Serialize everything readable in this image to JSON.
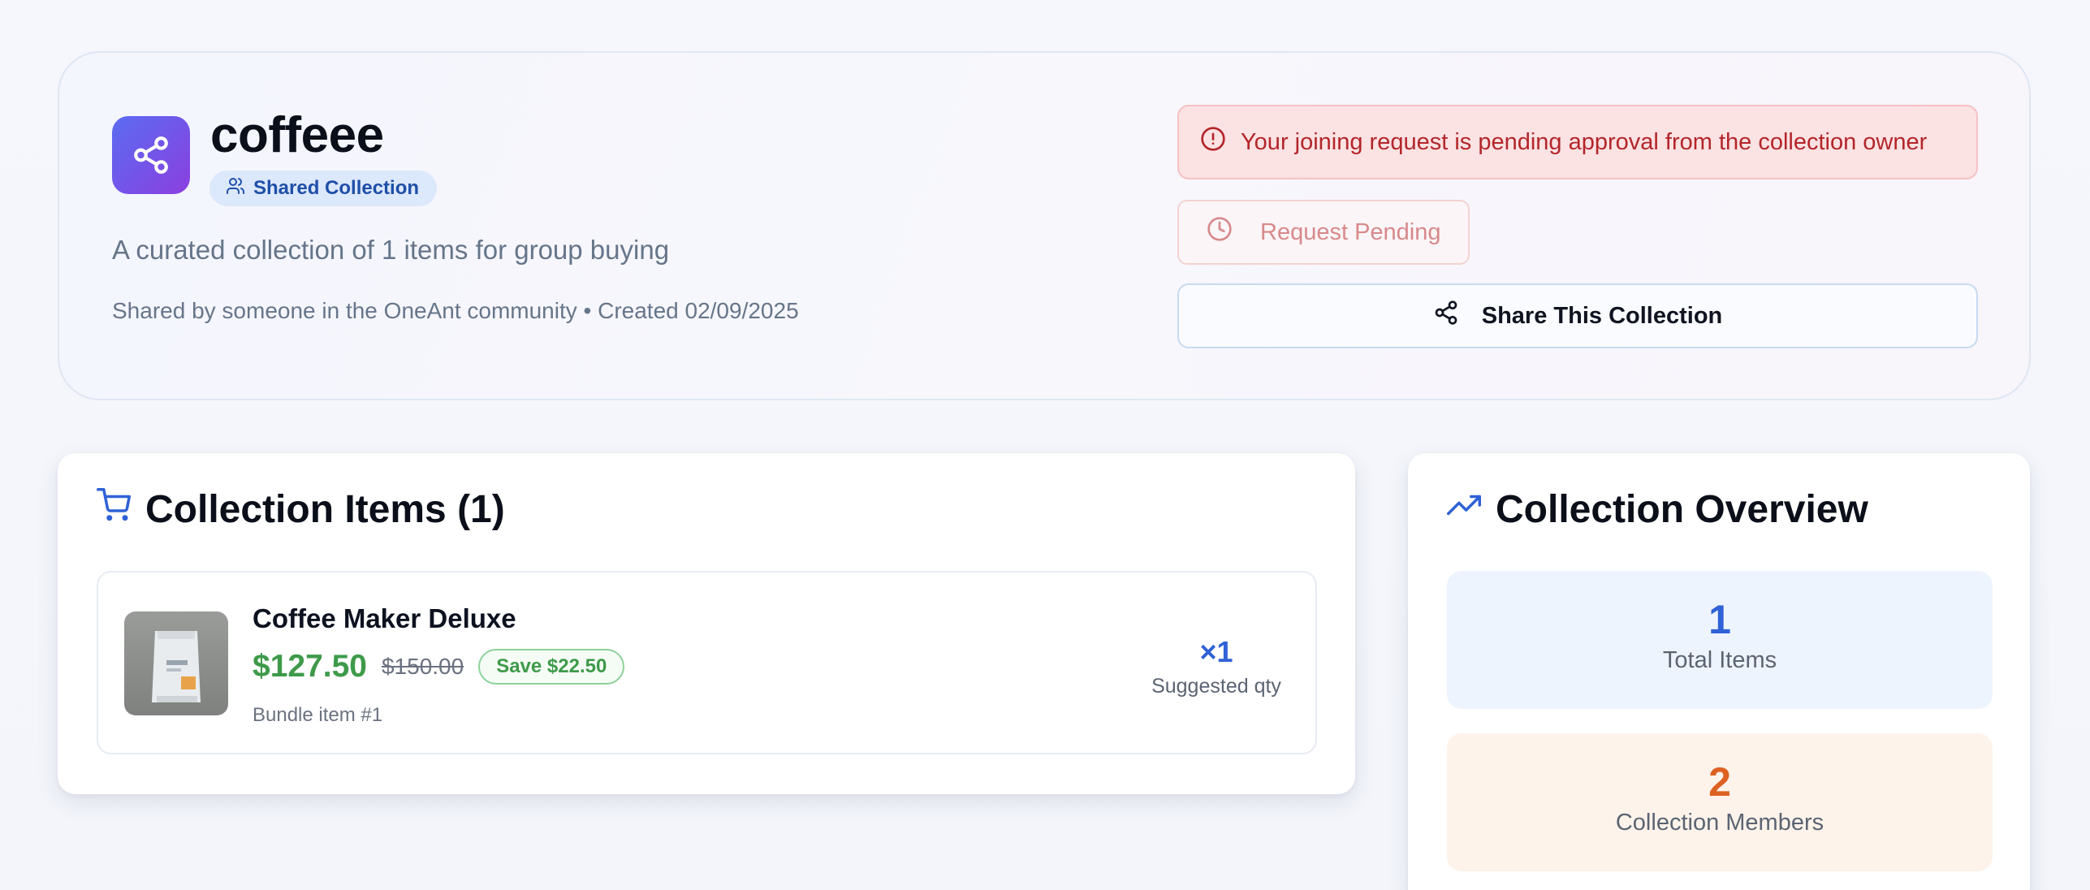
{
  "collection": {
    "title": "coffeee",
    "badge_label": "Shared Collection",
    "description": "A curated collection of 1 items for group buying",
    "meta": "Shared by someone in the OneAnt community • Created 02/09/2025",
    "icon": "share-icon"
  },
  "actions": {
    "alert_text": "Your joining request is pending approval from the collection owner",
    "pending_label": "Request Pending",
    "share_label": "Share This Collection"
  },
  "items_section": {
    "heading": "Collection Items (1)",
    "icon": "cart-icon",
    "items": [
      {
        "name": "Coffee Maker Deluxe",
        "price": "$127.50",
        "original_price": "$150.00",
        "savings": "Save $22.50",
        "bundle_label": "Bundle item #1",
        "qty": "×1",
        "qty_label": "Suggested qty"
      }
    ]
  },
  "overview": {
    "heading": "Collection Overview",
    "icon": "trending-up-icon",
    "stats": [
      {
        "value": "1",
        "label": "Total Items",
        "color": "#2f62d6"
      },
      {
        "value": "2",
        "label": "Collection Members",
        "color": "#dd6222"
      }
    ]
  },
  "colors": {
    "accent_blue": "#2f62d6",
    "price_green": "#3e9a4a",
    "alert_red": "#b3262a",
    "members_orange": "#dd6222"
  }
}
